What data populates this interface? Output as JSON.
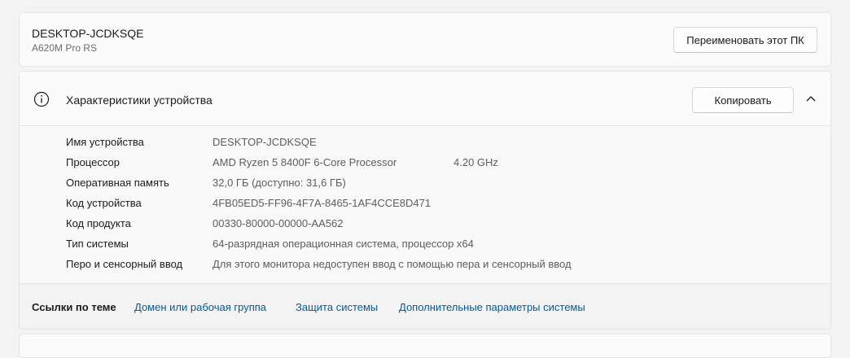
{
  "pc": {
    "name": "DESKTOP-JCDKSQE",
    "model": "A620M Pro RS",
    "rename_label": "Переименовать этот ПК"
  },
  "specs": {
    "title": "Характеристики устройства",
    "copy_label": "Копировать",
    "expanded": true,
    "rows": [
      {
        "label": "Имя устройства",
        "value": "DESKTOP-JCDKSQE"
      },
      {
        "label": "Процессор",
        "value": "AMD Ryzen 5 8400F 6-Core Processor",
        "extra": "4.20 GHz"
      },
      {
        "label": "Оперативная память",
        "value": "32,0 ГБ (доступно: 31,6 ГБ)"
      },
      {
        "label": "Код устройства",
        "value": "4FB05ED5-FF96-4F7A-8465-1AF4CCE8D471"
      },
      {
        "label": "Код продукта",
        "value": "00330-80000-00000-AA562"
      },
      {
        "label": "Тип системы",
        "value": "64-разрядная операционная система, процессор x64"
      },
      {
        "label": "Перо и сенсорный ввод",
        "value": "Для этого монитора недоступен ввод с помощью пера и сенсорный ввод"
      }
    ]
  },
  "links": {
    "title": "Ссылки по теме",
    "items": [
      {
        "label": "Домен или рабочая группа"
      },
      {
        "label": "Защита системы"
      },
      {
        "label": "Дополнительные параметры системы"
      }
    ]
  },
  "colors": {
    "link": "#005a9e",
    "background": "#f3f3f3",
    "card": "#fbfbfb"
  }
}
